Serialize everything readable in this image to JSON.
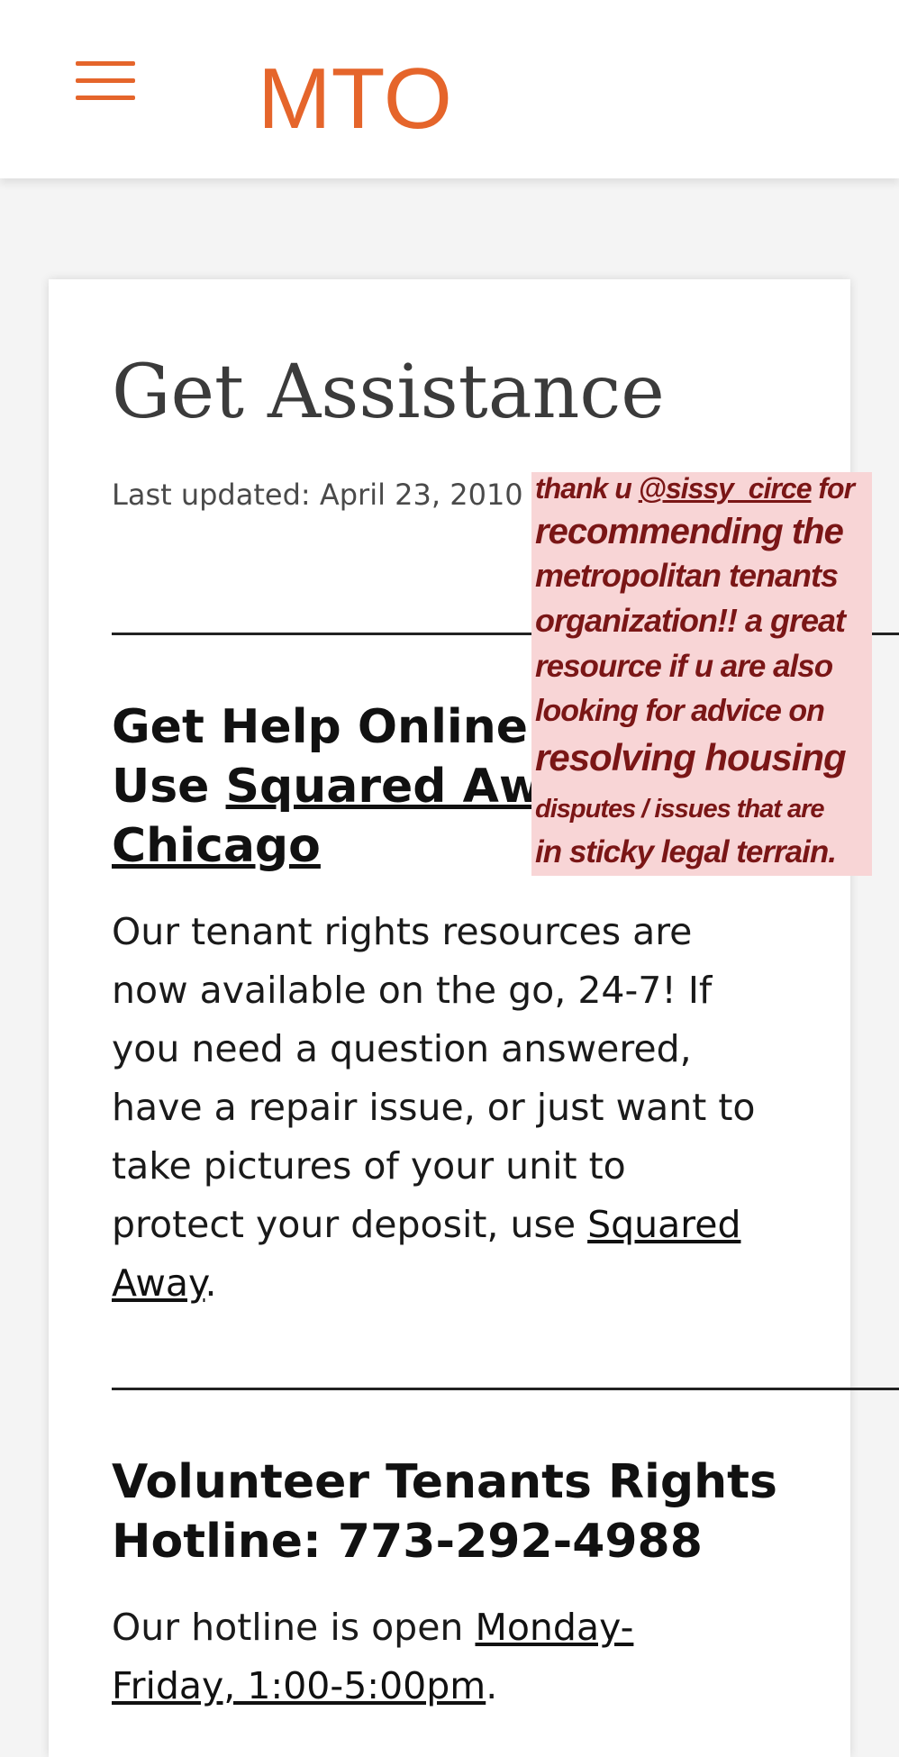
{
  "header": {
    "logo_text": "MTO",
    "brand_color": "#e5652b",
    "menu_icon": "hamburger-icon"
  },
  "page": {
    "title": "Get Assistance",
    "last_updated": "Last updated: April 23, 2010 –"
  },
  "section1": {
    "heading_line1": "Get Help Online:",
    "heading_prefix": "Use ",
    "heading_link_a": "Squared Aw",
    "heading_link_b": "Chicago",
    "paragraph_lines": [
      "Our tenant rights resources are",
      "now available on the go, 24-7! If",
      "you need a question answered,",
      "have a repair issue, or just want to",
      "take pictures of your unit to"
    ],
    "paragraph_end_prefix": "protect your deposit, use ",
    "paragraph_link_a": "Squared",
    "paragraph_link_b": "Away",
    "paragraph_end_suffix": "."
  },
  "section2": {
    "heading_line1": "Volunteer Tenants Rights",
    "heading_line2": "Hotline:  773-292-4988",
    "paragraph_prefix": "Our hotline is open ",
    "paragraph_link_a": "Monday-",
    "paragraph_link_b": "Friday, 1:00-5:00pm",
    "paragraph_suffix": "."
  },
  "overlay": {
    "line1_prefix": "thank u ",
    "line1_mention": "@sissy_circe",
    "line1_suffix": " for",
    "lines": [
      "recommending the",
      "metropolitan tenants",
      "organization!! a great",
      "resource if u are also",
      "looking for advice on",
      "resolving housing",
      "disputes / issues that are",
      "in sticky legal terrain."
    ],
    "bg_color": "#f8d5d6",
    "text_color": "#7a1616"
  }
}
